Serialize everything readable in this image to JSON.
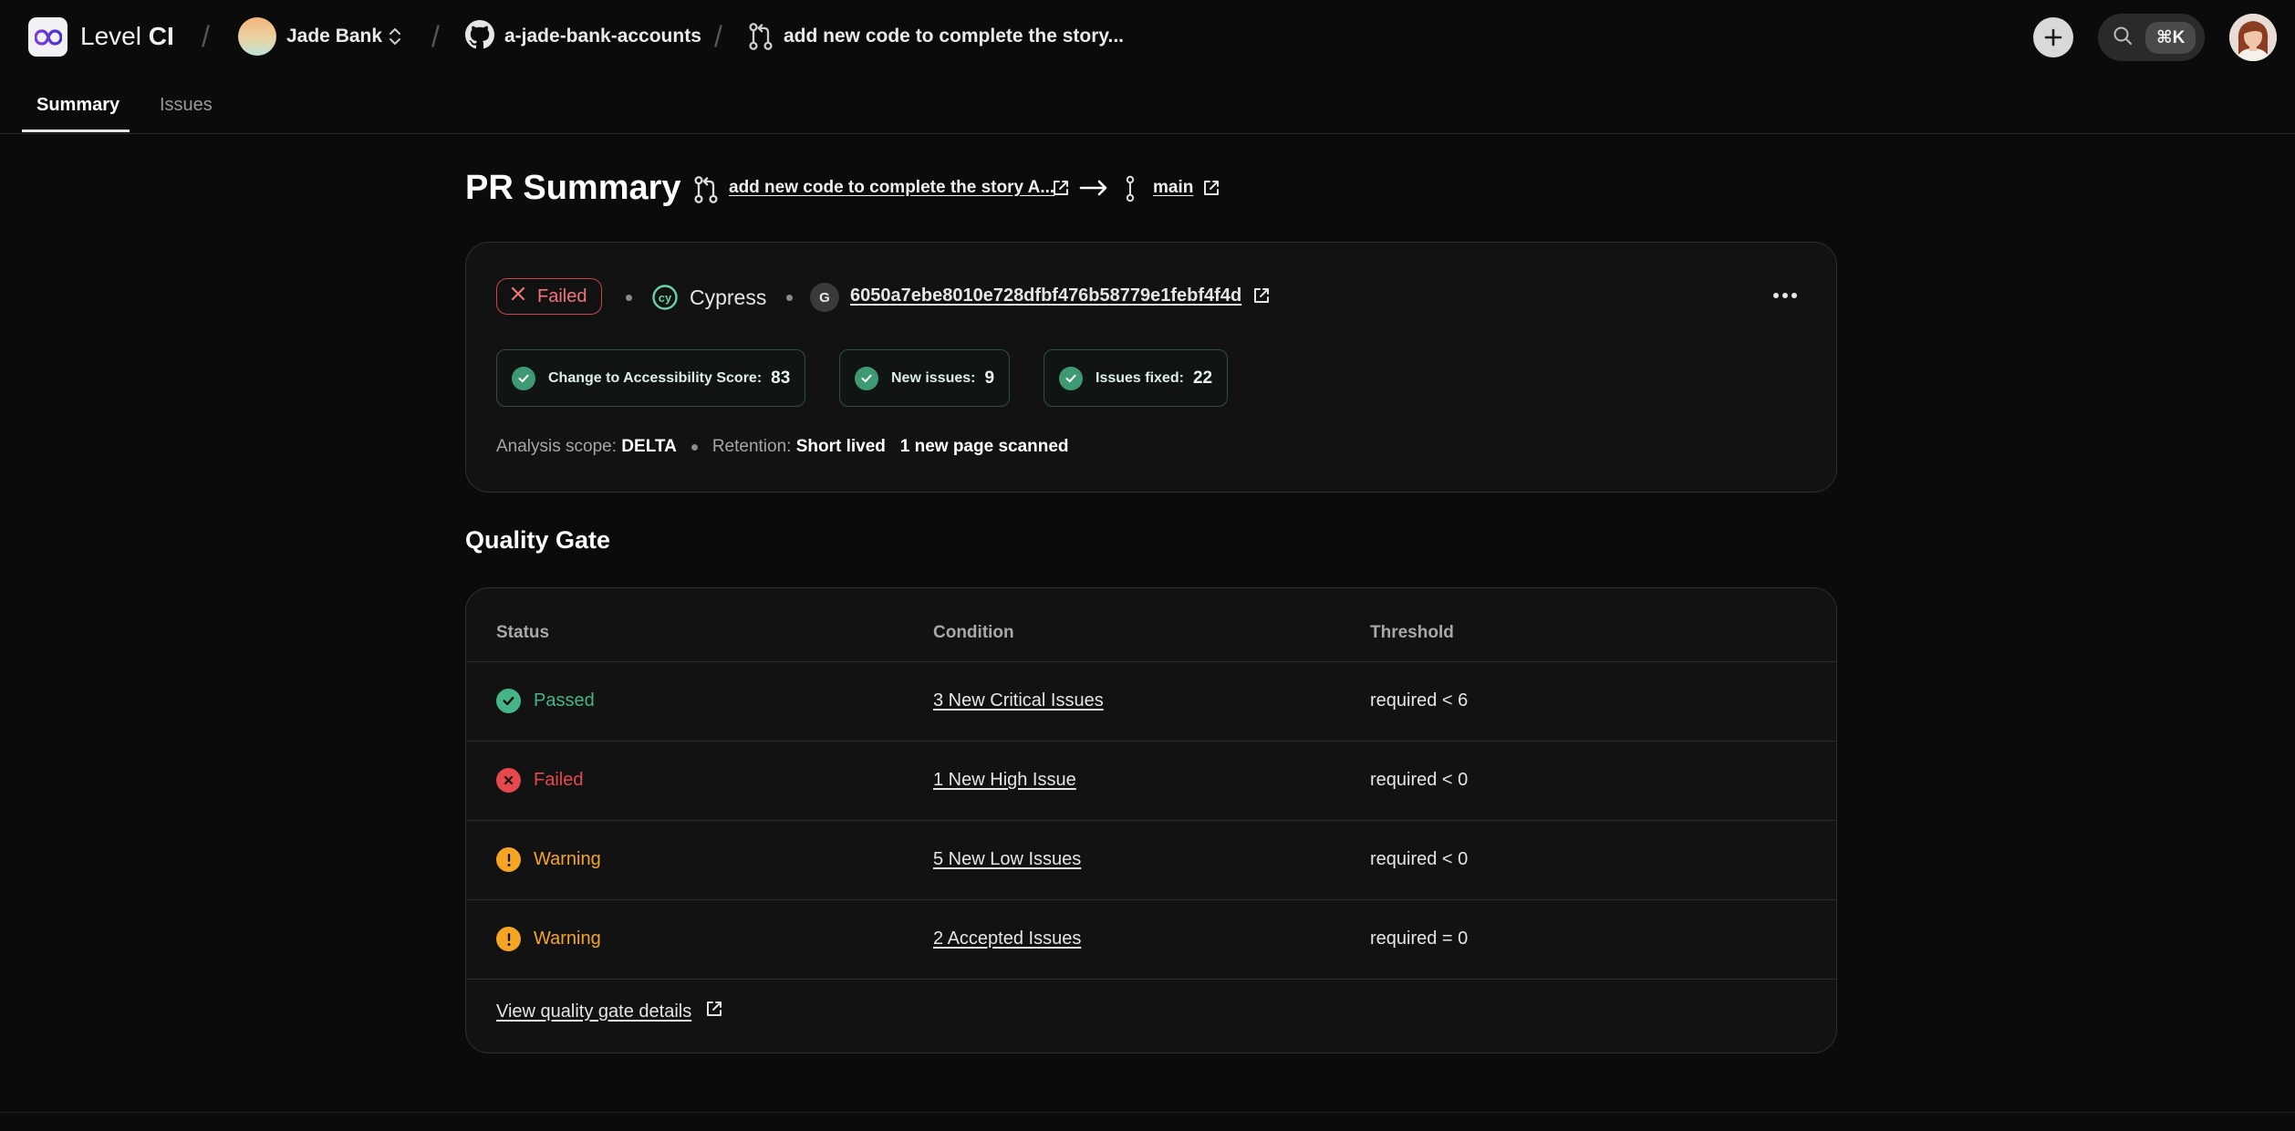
{
  "app": {
    "name_light": "Level",
    "name_bold": "CI"
  },
  "breadcrumb": {
    "org": "Jade Bank",
    "repo": "a-jade-bank-accounts",
    "pr": "add new code to complete the story..."
  },
  "search": {
    "shortcut": "⌘K"
  },
  "tabs": [
    {
      "label": "Summary",
      "active": true
    },
    {
      "label": "Issues",
      "active": false
    }
  ],
  "header": {
    "title": "PR Summary",
    "source_branch": "add new code to complete the story A...",
    "target_branch": "main"
  },
  "summary": {
    "status": "Failed",
    "tool": "Cypress",
    "commit_avatar": "G",
    "commit_sha": "6050a7ebe8010e728dfbf476b58779e1febf4f4d",
    "metrics": [
      {
        "label": "Change to Accessibility Score:",
        "value": "83"
      },
      {
        "label": "New issues:",
        "value": "9"
      },
      {
        "label": "Issues fixed:",
        "value": "22"
      }
    ],
    "scope_label": "Analysis scope:",
    "scope_value": "DELTA",
    "retention_label": "Retention:",
    "retention_value": "Short lived",
    "pages_scanned": "1 new page scanned"
  },
  "quality_gate": {
    "title": "Quality Gate",
    "columns": [
      "Status",
      "Condition",
      "Threshold"
    ],
    "rows": [
      {
        "status": "Passed",
        "condition": "3 New Critical Issues",
        "threshold": "required < 6"
      },
      {
        "status": "Failed",
        "condition": "1 New High Issue",
        "threshold": "required < 0"
      },
      {
        "status": "Warning",
        "condition": "5 New Low Issues",
        "threshold": "required < 0"
      },
      {
        "status": "Warning",
        "condition": "2 Accepted Issues",
        "threshold": "required = 0"
      }
    ],
    "details_link": "View quality gate details"
  },
  "colors": {
    "passed": "#45b587",
    "failed": "#e5484d",
    "warning": "#f5a524",
    "background": "#0b0b0b",
    "card": "#121212"
  }
}
